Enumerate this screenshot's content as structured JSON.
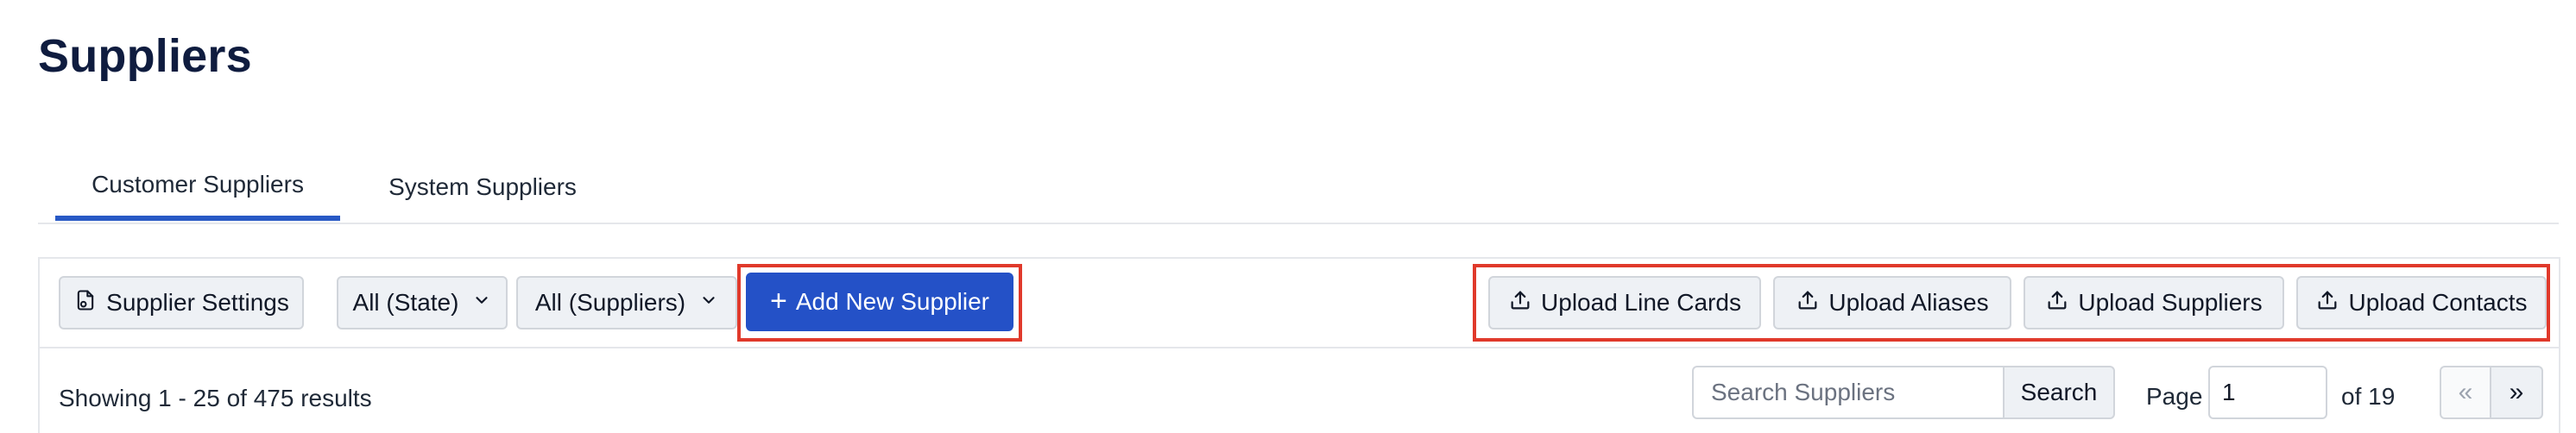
{
  "page": {
    "title": "Suppliers"
  },
  "tabs": [
    {
      "label": "Customer Suppliers",
      "active": true
    },
    {
      "label": "System Suppliers",
      "active": false
    }
  ],
  "toolbar": {
    "settings_label": "Supplier Settings",
    "state_filter": "All (State)",
    "supplier_filter": "All (Suppliers)",
    "add_label": "Add New Supplier",
    "upload_line_cards": "Upload Line Cards",
    "upload_aliases": "Upload Aliases",
    "upload_suppliers": "Upload Suppliers",
    "upload_contacts": "Upload Contacts"
  },
  "results": {
    "summary": "Showing 1 - 25 of 475 results"
  },
  "search": {
    "placeholder": "Search Suppliers",
    "button": "Search"
  },
  "pagination": {
    "page_label": "Page",
    "current_page": "1",
    "of_label": "of 19",
    "prev": "«",
    "next": "»"
  },
  "colors": {
    "primary": "#2451c7",
    "highlight": "#e0392b",
    "active_tab": "#2859c5"
  },
  "icons": {
    "settings": "gear-document-icon",
    "upload": "upload-icon",
    "dropdown": "chevron-down-icon",
    "add": "plus-icon"
  }
}
